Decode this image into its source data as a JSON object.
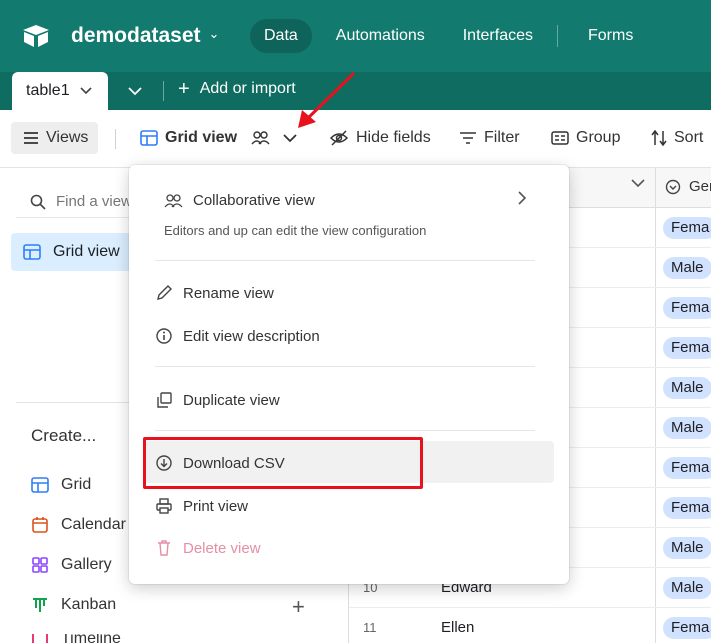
{
  "app": {
    "base_name": "demodataset",
    "nav": [
      "Data",
      "Automations",
      "Interfaces",
      "Forms"
    ],
    "active_nav": "Data"
  },
  "tabs": {
    "table": "table1",
    "add": "Add or import"
  },
  "toolbar": {
    "views": "Views",
    "grid_view": "Grid view",
    "hide_fields": "Hide fields",
    "filter": "Filter",
    "group": "Group",
    "sort": "Sort"
  },
  "sidebar": {
    "find_placeholder": "Find a view",
    "active_view": "Grid view",
    "create_title": "Create...",
    "create_items": [
      "Grid",
      "Calendar",
      "Gallery",
      "Kanban",
      "Timeline"
    ]
  },
  "grid": {
    "gender_header": "Gen",
    "rows": [
      {
        "num": "",
        "name": "",
        "gender": "Fema"
      },
      {
        "num": "",
        "name": "",
        "gender": "Male"
      },
      {
        "num": "",
        "name": "",
        "gender": "Fema"
      },
      {
        "num": "",
        "name": "",
        "gender": "Fema"
      },
      {
        "num": "",
        "name": "",
        "gender": "Male"
      },
      {
        "num": "",
        "name": "",
        "gender": "Male"
      },
      {
        "num": "",
        "name": "",
        "gender": "Fema"
      },
      {
        "num": "",
        "name": "",
        "gender": "Fema"
      },
      {
        "num": "",
        "name": "",
        "gender": "Male"
      },
      {
        "num": "10",
        "name": "Edward",
        "gender": "Male"
      },
      {
        "num": "11",
        "name": "Ellen",
        "gender": "Fema"
      }
    ]
  },
  "menu": {
    "collab_title": "Collaborative view",
    "collab_desc": "Editors and up can edit the view configuration",
    "rename": "Rename view",
    "edit_desc": "Edit view description",
    "duplicate": "Duplicate view",
    "download": "Download CSV",
    "print": "Print view",
    "delete": "Delete view"
  },
  "colors": {
    "header": "#127a6e",
    "tabbar": "#0e6c61",
    "highlight": "#e8121c",
    "delete_text": "#e58fa6"
  }
}
